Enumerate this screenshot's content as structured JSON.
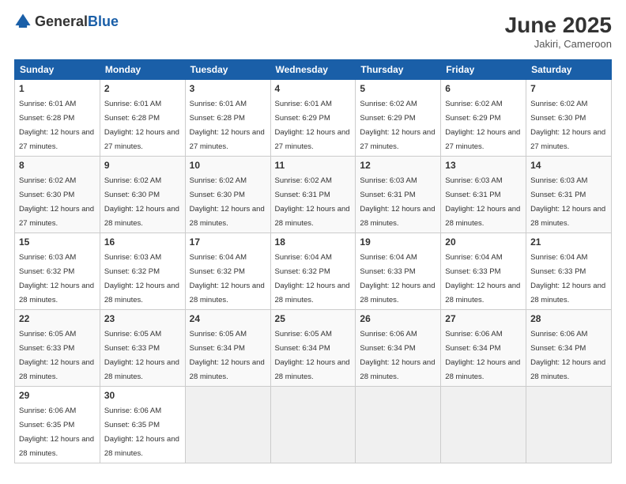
{
  "header": {
    "logo_general": "General",
    "logo_blue": "Blue",
    "month_year": "June 2025",
    "location": "Jakiri, Cameroon"
  },
  "days_of_week": [
    "Sunday",
    "Monday",
    "Tuesday",
    "Wednesday",
    "Thursday",
    "Friday",
    "Saturday"
  ],
  "weeks": [
    [
      {
        "day": "1",
        "sunrise": "6:01 AM",
        "sunset": "6:28 PM",
        "daylight": "12 hours and 27 minutes."
      },
      {
        "day": "2",
        "sunrise": "6:01 AM",
        "sunset": "6:28 PM",
        "daylight": "12 hours and 27 minutes."
      },
      {
        "day": "3",
        "sunrise": "6:01 AM",
        "sunset": "6:28 PM",
        "daylight": "12 hours and 27 minutes."
      },
      {
        "day": "4",
        "sunrise": "6:01 AM",
        "sunset": "6:29 PM",
        "daylight": "12 hours and 27 minutes."
      },
      {
        "day": "5",
        "sunrise": "6:02 AM",
        "sunset": "6:29 PM",
        "daylight": "12 hours and 27 minutes."
      },
      {
        "day": "6",
        "sunrise": "6:02 AM",
        "sunset": "6:29 PM",
        "daylight": "12 hours and 27 minutes."
      },
      {
        "day": "7",
        "sunrise": "6:02 AM",
        "sunset": "6:30 PM",
        "daylight": "12 hours and 27 minutes."
      }
    ],
    [
      {
        "day": "8",
        "sunrise": "6:02 AM",
        "sunset": "6:30 PM",
        "daylight": "12 hours and 27 minutes."
      },
      {
        "day": "9",
        "sunrise": "6:02 AM",
        "sunset": "6:30 PM",
        "daylight": "12 hours and 28 minutes."
      },
      {
        "day": "10",
        "sunrise": "6:02 AM",
        "sunset": "6:30 PM",
        "daylight": "12 hours and 28 minutes."
      },
      {
        "day": "11",
        "sunrise": "6:02 AM",
        "sunset": "6:31 PM",
        "daylight": "12 hours and 28 minutes."
      },
      {
        "day": "12",
        "sunrise": "6:03 AM",
        "sunset": "6:31 PM",
        "daylight": "12 hours and 28 minutes."
      },
      {
        "day": "13",
        "sunrise": "6:03 AM",
        "sunset": "6:31 PM",
        "daylight": "12 hours and 28 minutes."
      },
      {
        "day": "14",
        "sunrise": "6:03 AM",
        "sunset": "6:31 PM",
        "daylight": "12 hours and 28 minutes."
      }
    ],
    [
      {
        "day": "15",
        "sunrise": "6:03 AM",
        "sunset": "6:32 PM",
        "daylight": "12 hours and 28 minutes."
      },
      {
        "day": "16",
        "sunrise": "6:03 AM",
        "sunset": "6:32 PM",
        "daylight": "12 hours and 28 minutes."
      },
      {
        "day": "17",
        "sunrise": "6:04 AM",
        "sunset": "6:32 PM",
        "daylight": "12 hours and 28 minutes."
      },
      {
        "day": "18",
        "sunrise": "6:04 AM",
        "sunset": "6:32 PM",
        "daylight": "12 hours and 28 minutes."
      },
      {
        "day": "19",
        "sunrise": "6:04 AM",
        "sunset": "6:33 PM",
        "daylight": "12 hours and 28 minutes."
      },
      {
        "day": "20",
        "sunrise": "6:04 AM",
        "sunset": "6:33 PM",
        "daylight": "12 hours and 28 minutes."
      },
      {
        "day": "21",
        "sunrise": "6:04 AM",
        "sunset": "6:33 PM",
        "daylight": "12 hours and 28 minutes."
      }
    ],
    [
      {
        "day": "22",
        "sunrise": "6:05 AM",
        "sunset": "6:33 PM",
        "daylight": "12 hours and 28 minutes."
      },
      {
        "day": "23",
        "sunrise": "6:05 AM",
        "sunset": "6:33 PM",
        "daylight": "12 hours and 28 minutes."
      },
      {
        "day": "24",
        "sunrise": "6:05 AM",
        "sunset": "6:34 PM",
        "daylight": "12 hours and 28 minutes."
      },
      {
        "day": "25",
        "sunrise": "6:05 AM",
        "sunset": "6:34 PM",
        "daylight": "12 hours and 28 minutes."
      },
      {
        "day": "26",
        "sunrise": "6:06 AM",
        "sunset": "6:34 PM",
        "daylight": "12 hours and 28 minutes."
      },
      {
        "day": "27",
        "sunrise": "6:06 AM",
        "sunset": "6:34 PM",
        "daylight": "12 hours and 28 minutes."
      },
      {
        "day": "28",
        "sunrise": "6:06 AM",
        "sunset": "6:34 PM",
        "daylight": "12 hours and 28 minutes."
      }
    ],
    [
      {
        "day": "29",
        "sunrise": "6:06 AM",
        "sunset": "6:35 PM",
        "daylight": "12 hours and 28 minutes."
      },
      {
        "day": "30",
        "sunrise": "6:06 AM",
        "sunset": "6:35 PM",
        "daylight": "12 hours and 28 minutes."
      },
      null,
      null,
      null,
      null,
      null
    ]
  ]
}
